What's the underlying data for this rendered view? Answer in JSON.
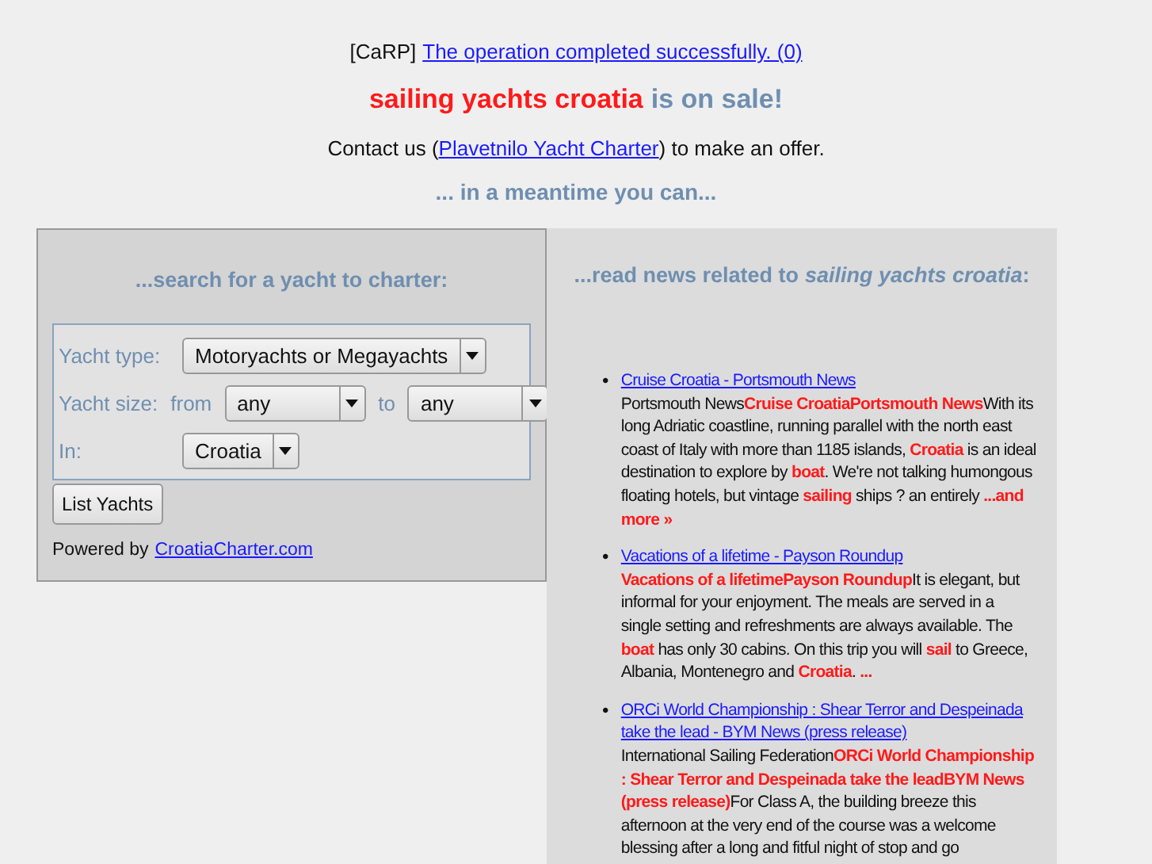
{
  "notice": {
    "tag": "[CaRP]",
    "link": "The operation completed successfully. (0)"
  },
  "headline": {
    "domain": "sailing yachts croatia",
    "text": "is on sale!"
  },
  "contact": {
    "before": "Contact us (",
    "link": "Plavetnilo Yacht Charter",
    "after": ") to make an offer."
  },
  "subheading": "... in a meantime you can...",
  "search_panel": {
    "title": "...search for a yacht to charter:",
    "fields": [
      {
        "kind": "single",
        "label": "Yacht type:",
        "value": "Motoryachts or Megayachts"
      },
      {
        "kind": "range",
        "label": "Yacht size:",
        "from_label": "from",
        "from_value": "any",
        "to_label": "to",
        "to_value": "any"
      },
      {
        "kind": "single",
        "label": "In:",
        "value": "Croatia"
      }
    ],
    "button": "List Yachts",
    "powered_by": "Powered by",
    "powered_link": "CroatiaCharter.com"
  },
  "news_panel": {
    "title_before": "...read news related to",
    "title_topic": "sailing yachts croatia",
    "title_after": ":",
    "items": [
      {
        "marker": "•",
        "link": "Cruise Croatia - Portsmouth News",
        "body": "Portsmouth News**Cruise CroatiaPortsmouth News**With its long Adriatic coastline, running parallel with the north east coast of Italy with more than 1185 islands, **Croatia** is an ideal destination to explore by **boat**. We're not talking humongous floating hotels, but vintage **sailing** ships ? an entirely **...and more »**"
      },
      {
        "marker": "•",
        "link": "Vacations of a lifetime - Payson Roundup",
        "body": "**Vacations of a lifetimePayson Roundup**It is elegant, but informal for your enjoyment. The meals are served in a single setting and refreshments are always available. The **boat** has only 30 cabins. On this trip you will **sail** to Greece, Albania, Montenegro and **Croatia**. **...**"
      },
      {
        "marker": "•",
        "link": "ORCi World Championship : Shear Terror and Despeinada take the lead - BYM News (press release)",
        "body": "International Sailing Federation**ORCi World Championship : Shear Terror and Despeinada take the leadBYM News (press release)**For Class A, the building breeze this afternoon at the very end of the course was a welcome blessing after a long and fitful night of stop and go"
      }
    ]
  }
}
